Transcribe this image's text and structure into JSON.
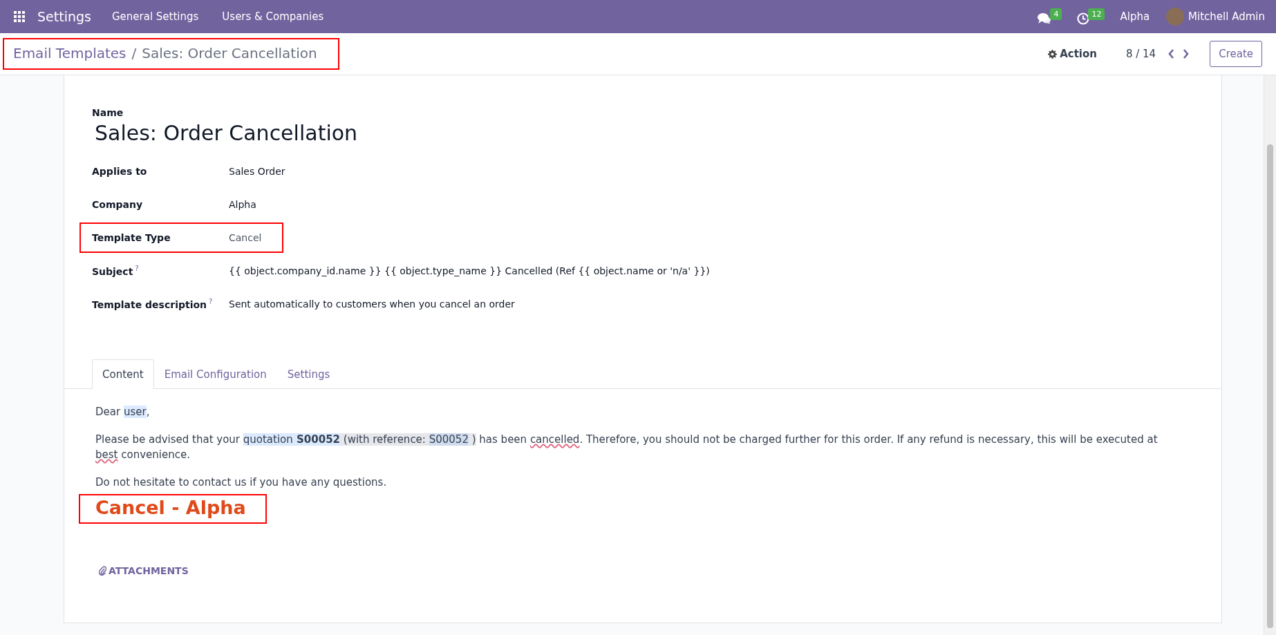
{
  "navbar": {
    "app_name": "Settings",
    "menu": [
      "General Settings",
      "Users & Companies"
    ],
    "messages_count": "4",
    "activities_count": "12",
    "company": "Alpha",
    "user": "Mitchell Admin"
  },
  "control_panel": {
    "breadcrumb": [
      {
        "text": "Email Templates",
        "kind": "link"
      },
      {
        "text": "Sales: Order Cancellation",
        "kind": "current"
      }
    ],
    "breadcrumb_separator": "/",
    "breadcrumb_highlighted": true,
    "action": "Action",
    "pager": "8 / 14",
    "create": "Create"
  },
  "form": {
    "name_label": "Name",
    "name": "Sales: Order Cancellation",
    "fields": [
      {
        "label": "Applies to",
        "value": "Sales Order",
        "help": false,
        "highlighted": false
      },
      {
        "label": "Company",
        "value": "Alpha",
        "help": false,
        "highlighted": false
      },
      {
        "label": "Template Type",
        "value": "Cancel",
        "help": false,
        "highlighted": true
      },
      {
        "label": "Subject",
        "value": "{{ object.company_id.name }} {{ object.type_name }} Cancelled (Ref {{ object.name or 'n/a' }})",
        "help": true,
        "highlighted": false
      },
      {
        "label": "Template description",
        "value": "Sent automatically to customers when you cancel an order",
        "help": true,
        "highlighted": false
      }
    ],
    "help_mark": "?",
    "tabs": [
      {
        "label": "Content",
        "selected": true
      },
      {
        "label": "Email Configuration",
        "selected": false
      },
      {
        "label": "Settings",
        "selected": false
      }
    ],
    "body": [
      {
        "kind": "paragraph",
        "segments": [
          {
            "kind": "plain",
            "text": "Dear "
          },
          {
            "kind": "field",
            "text": "user"
          },
          {
            "kind": "plain",
            "text": ","
          }
        ]
      },
      {
        "kind": "paragraph",
        "segments": [
          {
            "kind": "plain",
            "text": "Please be advised that your "
          },
          {
            "kind": "field",
            "text": "quotation"
          },
          {
            "kind": "strong-field",
            "text": " S00052"
          },
          {
            "kind": "ref",
            "text": " (with reference: "
          },
          {
            "kind": "ref-field",
            "text": "S00052"
          },
          {
            "kind": "ref",
            "text": " )"
          },
          {
            "kind": "plain",
            "text": " has been "
          },
          {
            "kind": "misspelled",
            "text": "cancelled"
          },
          {
            "kind": "plain",
            "text": ". Therefore, you should not be charged further for this order. If any refund is necessary, this will be executed at "
          },
          {
            "kind": "misspelled",
            "text": "best"
          },
          {
            "kind": "plain",
            "text": " convenience."
          }
        ]
      },
      {
        "kind": "paragraph",
        "segments": [
          {
            "kind": "plain",
            "text": "Do not hesitate to contact us if you have any questions."
          }
        ]
      },
      {
        "kind": "heading",
        "text": "Cancel - Alpha",
        "highlighted": true
      }
    ],
    "attachments": "ATTACHMENTS"
  }
}
